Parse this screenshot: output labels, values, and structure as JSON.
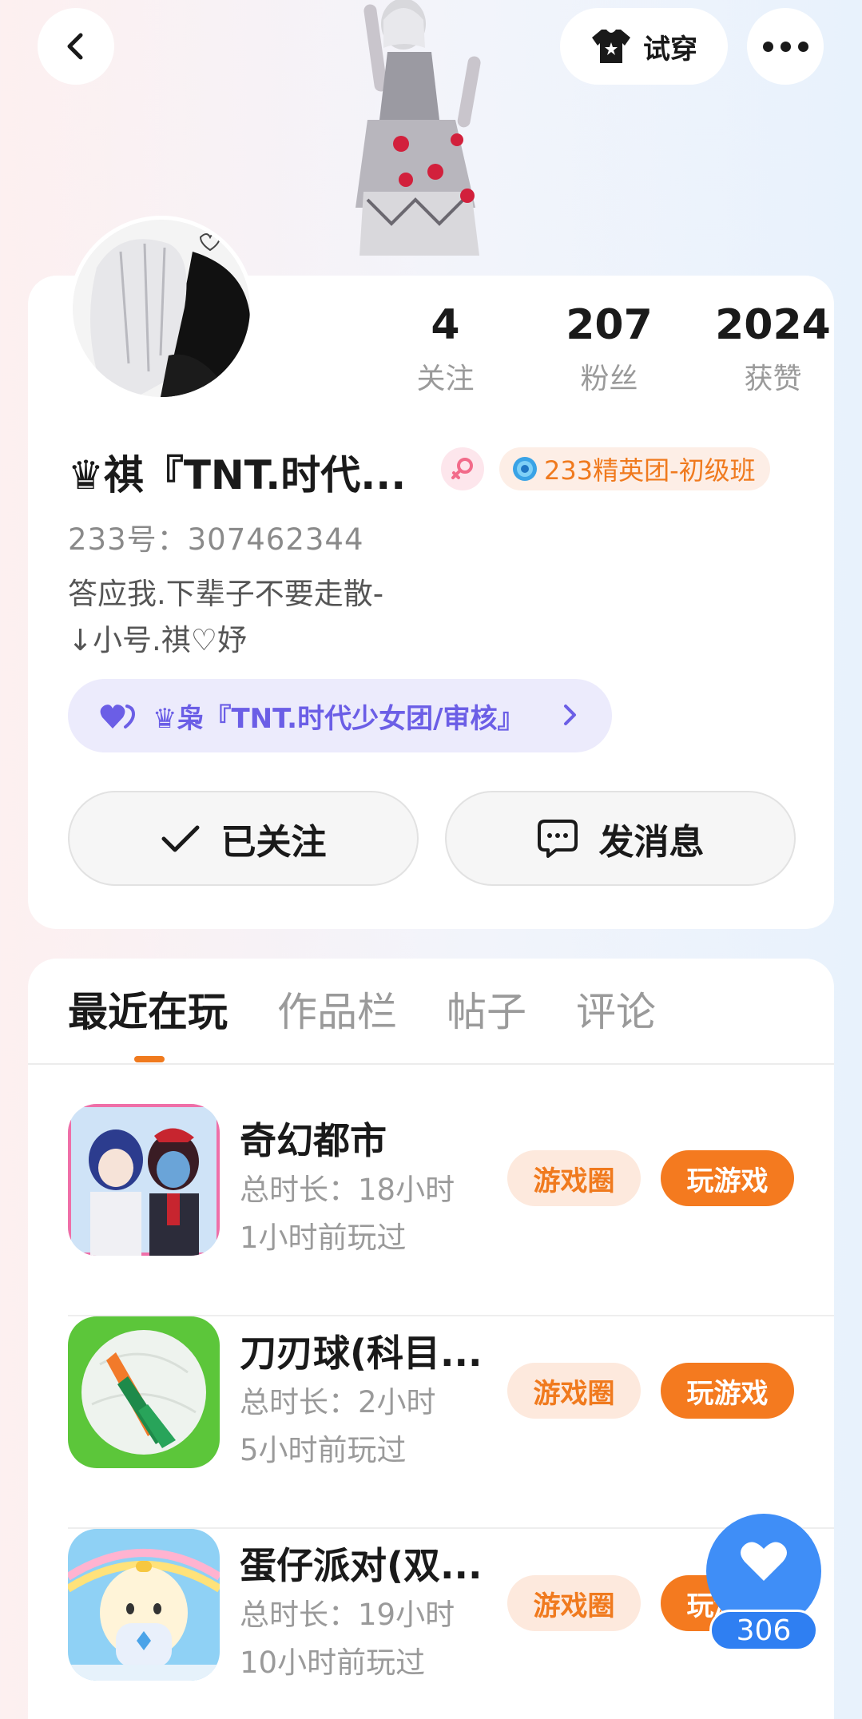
{
  "header": {
    "back_icon": "chevron-left-icon",
    "tryon_label": "试穿",
    "tryon_icon": "shirt-icon",
    "more_icon": "more-dots-icon"
  },
  "profile": {
    "stats": [
      {
        "value": "4",
        "label": "关注"
      },
      {
        "value": "207",
        "label": "粉丝"
      },
      {
        "value": "2024",
        "label": "获赞"
      }
    ],
    "username": "♛祺『TNT.时代...",
    "gender_icon": "female-icon",
    "elite_badge": "233精英团-初级班",
    "uid": "233号：307462344",
    "bio_line1": "答应我.下辈子不要走散-",
    "bio_line2": "↓小号.祺♡妤",
    "group_label": "♛枭『TNT.时代少女团/审核』",
    "follow_label": "已关注",
    "message_label": "发消息"
  },
  "tabs": [
    {
      "label": "最近在玩",
      "active": true
    },
    {
      "label": "作品栏",
      "active": false
    },
    {
      "label": "帖子",
      "active": false
    },
    {
      "label": "评论",
      "active": false
    }
  ],
  "games": [
    {
      "name": "奇幻都市",
      "time": "总时长：18小时",
      "last": "1小时前玩过",
      "circle": "游戏圈",
      "play": "玩游戏"
    },
    {
      "name": "刀刃球(科目...",
      "time": "总时长：2小时",
      "last": "5小时前玩过",
      "circle": "游戏圈",
      "play": "玩游戏"
    },
    {
      "name": "蛋仔派对(双...",
      "time": "总时长：19小时",
      "last": "10小时前玩过",
      "circle": "游戏圈",
      "play": "玩游戏"
    }
  ],
  "like": {
    "count": "306",
    "icon": "heart-icon"
  },
  "colors": {
    "accent": "#f07a1e",
    "group_purple": "#6b5ee6",
    "like_blue": "#3f8ef7"
  }
}
